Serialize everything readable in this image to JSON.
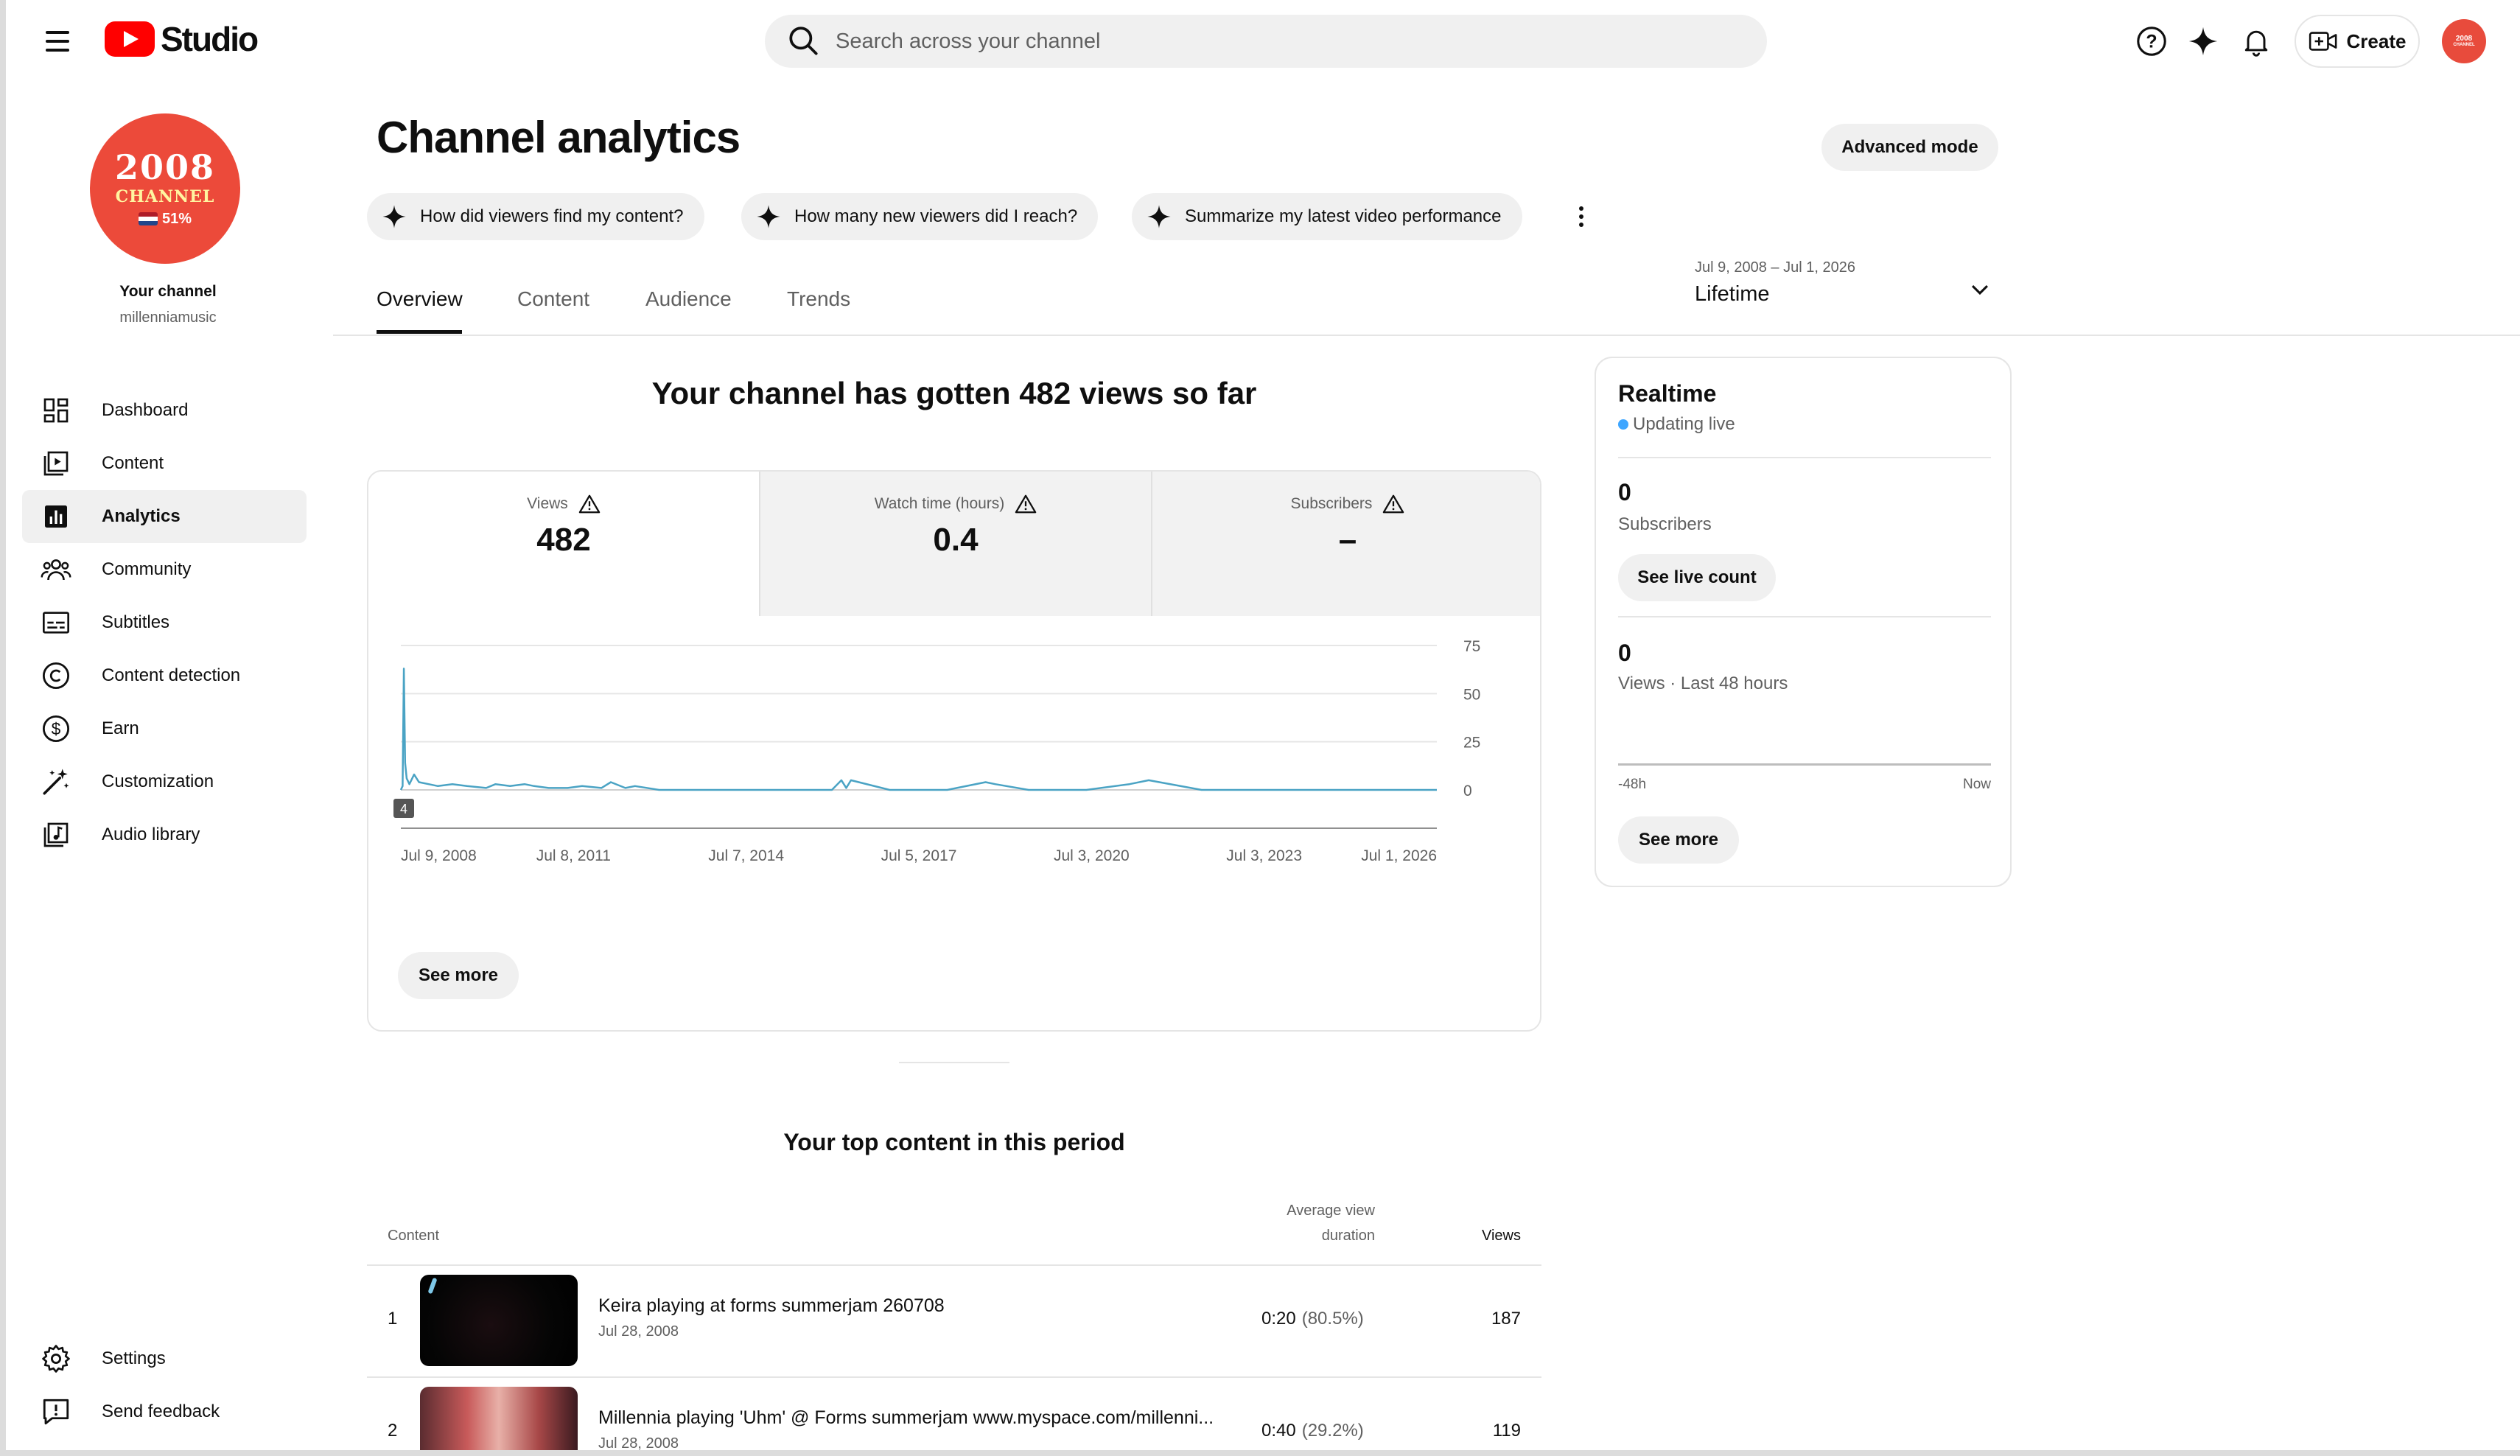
{
  "header": {
    "logo_text": "Studio",
    "search_placeholder": "Search across your channel",
    "create_label": "Create"
  },
  "account_avatar": {
    "line1": "2008",
    "line2": "CHANNEL",
    "line3": "51%"
  },
  "sidebar": {
    "your_channel": "Your channel",
    "handle": "millenniamusic",
    "items": [
      {
        "label": "Dashboard",
        "icon": "dashboard-icon"
      },
      {
        "label": "Content",
        "icon": "content-icon"
      },
      {
        "label": "Analytics",
        "icon": "analytics-icon",
        "active": true
      },
      {
        "label": "Community",
        "icon": "community-icon"
      },
      {
        "label": "Subtitles",
        "icon": "subtitles-icon"
      },
      {
        "label": "Content detection",
        "icon": "copyright-icon"
      },
      {
        "label": "Earn",
        "icon": "dollar-icon"
      },
      {
        "label": "Customization",
        "icon": "magic-wand-icon"
      },
      {
        "label": "Audio library",
        "icon": "audio-library-icon"
      }
    ],
    "bottom_items": [
      {
        "label": "Settings",
        "icon": "gear-icon"
      },
      {
        "label": "Send feedback",
        "icon": "feedback-icon"
      }
    ]
  },
  "main": {
    "title": "Channel analytics",
    "advanced_mode": "Advanced mode",
    "chips": [
      "How did viewers find my content?",
      "How many new viewers did I reach?",
      "Summarize my latest video performance"
    ],
    "tabs": [
      "Overview",
      "Content",
      "Audience",
      "Trends"
    ],
    "active_tab": "Overview",
    "date_range": {
      "range": "Jul 9, 2008 – Jul 1, 2026",
      "label": "Lifetime"
    },
    "headline": "Your channel has gotten 482 views so far",
    "metrics": [
      {
        "label": "Views",
        "value": "482"
      },
      {
        "label": "Watch time (hours)",
        "value": "0.4"
      },
      {
        "label": "Subscribers",
        "value": "–"
      }
    ],
    "chart_see_more": "See more",
    "top_content_title": "Your top content in this period",
    "table": {
      "col_content": "Content",
      "col_avd_line1": "Average view",
      "col_avd_line2": "duration",
      "col_views": "Views",
      "rows": [
        {
          "rank": "1",
          "title": "Keira playing at forms summerjam 260708",
          "date": "Jul 28, 2008",
          "avd": "0:20",
          "avd_pct": "(80.5%)",
          "views": "187"
        },
        {
          "rank": "2",
          "title": "Millennia playing 'Uhm' @ Forms summerjam www.myspace.com/millenni...",
          "date": "Jul 28, 2008",
          "avd": "0:40",
          "avd_pct": "(29.2%)",
          "views": "119"
        }
      ]
    }
  },
  "realtime": {
    "title": "Realtime",
    "status": "Updating live",
    "subscribers_value": "0",
    "subscribers_label": "Subscribers",
    "see_live_count": "See live count",
    "views_value": "0",
    "views_label": "Views · Last 48 hours",
    "axis_start": "-48h",
    "axis_end": "Now",
    "see_more": "See more"
  },
  "chart_data": {
    "type": "line",
    "title": "",
    "xlabel": "",
    "ylabel": "",
    "ylim": [
      0,
      75
    ],
    "y_ticks": [
      0,
      25,
      50,
      75
    ],
    "x_tick_labels": [
      "Jul 9, 2008",
      "Jul 8, 2011",
      "Jul 7, 2014",
      "Jul 5, 2017",
      "Jul 3, 2020",
      "Jul 3, 2023",
      "Jul 1, 2026"
    ],
    "x_range": [
      "2008-07-09",
      "2026-07-01"
    ],
    "annotation_marker": "4",
    "color": "#4aa3c4",
    "series": [
      {
        "x": [
          "2008-07-09",
          "2008-07-20",
          "2008-07-28",
          "2008-08-05",
          "2008-08-15",
          "2008-09-01",
          "2008-10-01",
          "2008-11-01",
          "2009-01-01",
          "2009-03-01",
          "2009-06-01",
          "2009-09-01",
          "2010-01-01",
          "2010-03-01",
          "2010-06-01",
          "2010-09-01",
          "2010-11-01",
          "2011-02-01",
          "2011-06-01",
          "2011-09-01",
          "2012-01-01",
          "2012-03-01",
          "2012-06-01",
          "2012-08-01",
          "2013-01-01",
          "2014-01-01",
          "2015-01-01",
          "2016-01-01",
          "2016-03-01",
          "2016-04-01",
          "2016-05-01",
          "2017-01-01",
          "2018-01-01",
          "2018-09-01",
          "2018-11-01",
          "2019-06-01",
          "2020-06-01",
          "2021-03-01",
          "2021-07-01",
          "2022-06-01",
          "2024-01-01",
          "2025-06-01",
          "2026-07-01"
        ],
        "y": [
          0,
          2,
          63,
          14,
          6,
          3,
          8,
          4,
          3,
          2,
          3,
          2,
          1,
          3,
          2,
          3,
          2,
          1,
          1,
          2,
          1,
          4,
          1,
          2,
          0,
          0,
          0,
          0,
          5,
          1,
          5,
          0,
          0,
          4,
          3,
          0,
          0,
          3,
          5,
          0,
          0,
          0,
          0
        ]
      }
    ]
  }
}
